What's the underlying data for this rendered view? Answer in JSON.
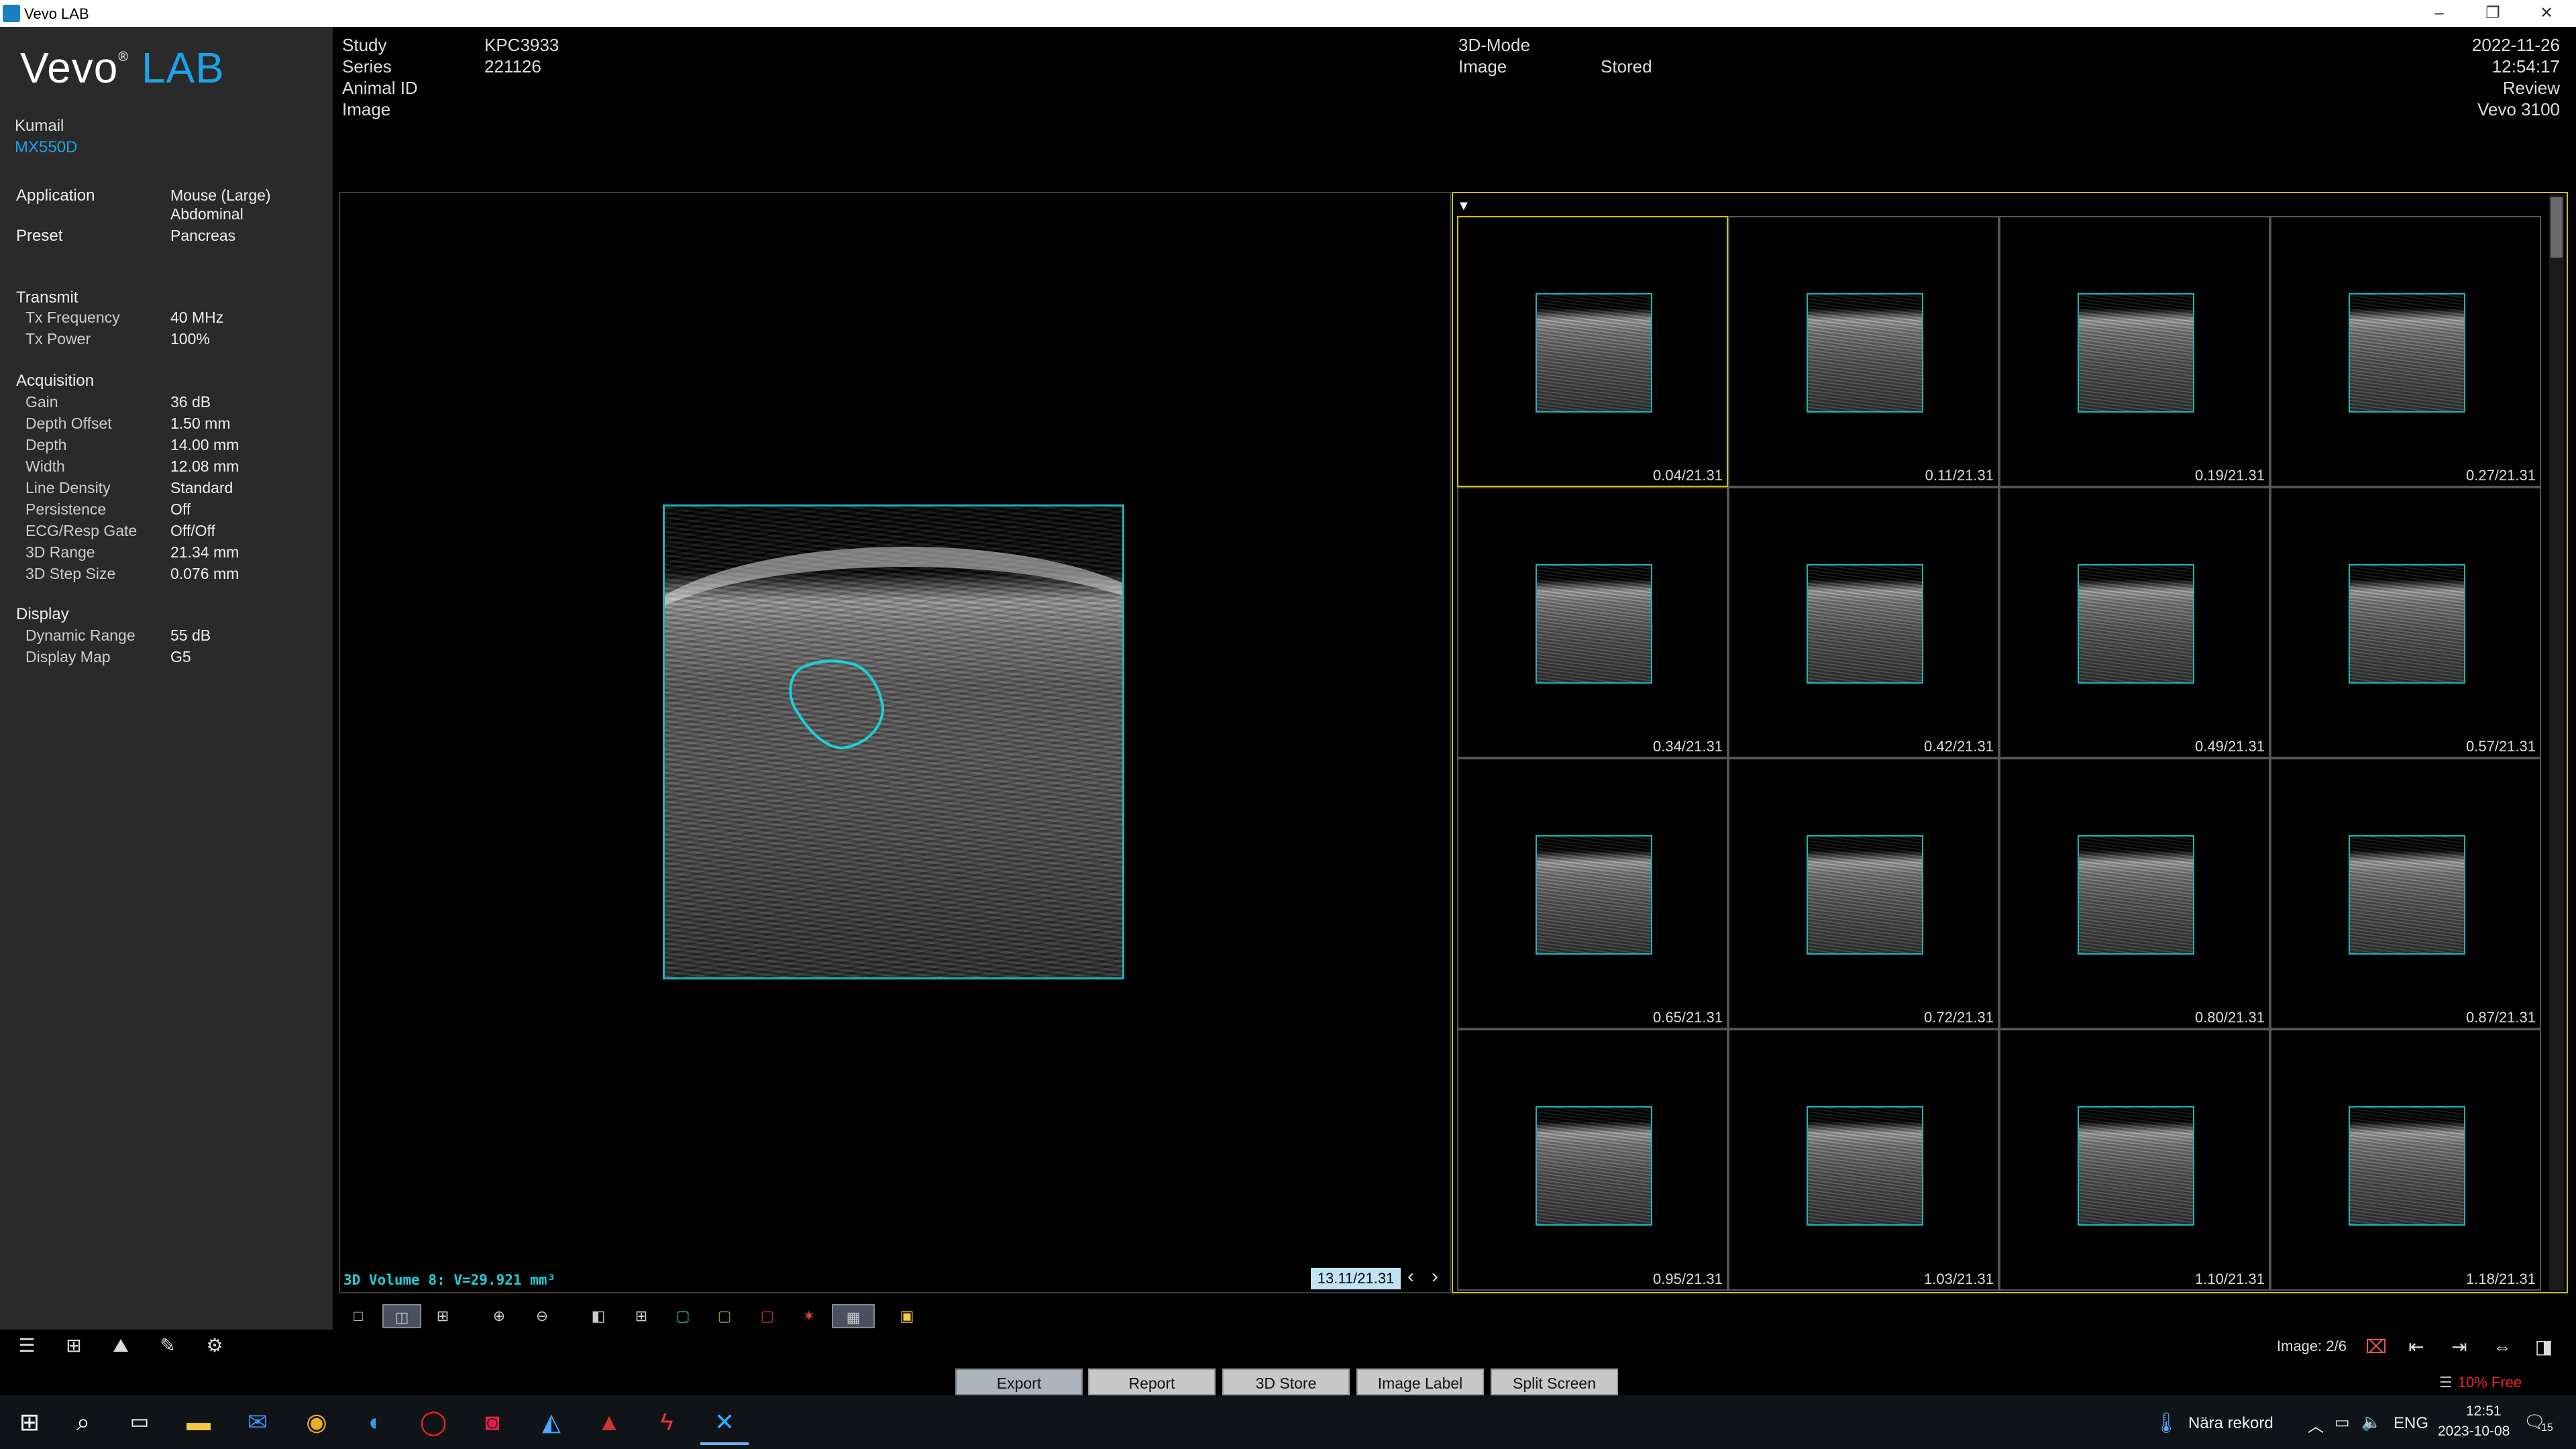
{
  "window": {
    "title": "Vevo LAB"
  },
  "logo": {
    "vevo": "Vevo",
    "reg": "®",
    "lab": "LAB"
  },
  "user": {
    "name": "Kumail",
    "transducer": "MX550D"
  },
  "info": {
    "application_label": "Application",
    "application_value": "Mouse (Large)",
    "application_value2": "Abdominal",
    "preset_label": "Preset",
    "preset_value": "Pancreas",
    "transmit_section": "Transmit",
    "transmit": [
      {
        "label": "Tx Frequency",
        "value": "40 MHz"
      },
      {
        "label": "Tx Power",
        "value": "100%"
      }
    ],
    "acquisition_section": "Acquisition",
    "acquisition": [
      {
        "label": "Gain",
        "value": "36 dB"
      },
      {
        "label": "Depth Offset",
        "value": "1.50 mm"
      },
      {
        "label": "Depth",
        "value": "14.00 mm"
      },
      {
        "label": "Width",
        "value": "12.08 mm"
      },
      {
        "label": "Line Density",
        "value": "Standard"
      },
      {
        "label": "Persistence",
        "value": "Off"
      },
      {
        "label": "ECG/Resp Gate",
        "value": "Off/Off"
      },
      {
        "label": "3D Range",
        "value": "21.34 mm"
      },
      {
        "label": "3D Step Size",
        "value": "0.076 mm"
      }
    ],
    "display_section": "Display",
    "display": [
      {
        "label": "Dynamic Range",
        "value": "55 dB"
      },
      {
        "label": "Display Map",
        "value": "G5"
      }
    ]
  },
  "header": {
    "study_label": "Study",
    "study_value": "KPC3933",
    "series_label": "Series",
    "series_value": "221126",
    "animal_label": "Animal ID",
    "image_label": "Image",
    "mode": "3D-Mode",
    "image2_label": "Image",
    "image2_value": "Stored",
    "date": "2022-11-26",
    "time": "12:54:17",
    "status": "Review",
    "system": "Vevo 3100"
  },
  "viewer": {
    "volume_text": "3D Volume 8: V=29.921 mm³",
    "frame_indicator": "13.11/21.31",
    "prev": "‹",
    "next": "›"
  },
  "thumbnails": [
    "0.04/21.31",
    "0.11/21.31",
    "0.19/21.31",
    "0.27/21.31",
    "0.34/21.31",
    "0.42/21.31",
    "0.49/21.31",
    "0.57/21.31",
    "0.65/21.31",
    "0.72/21.31",
    "0.80/21.31",
    "0.87/21.31",
    "0.95/21.31",
    "1.03/21.31",
    "1.10/21.31",
    "1.18/21.31"
  ],
  "image_count": "Image: 2/6",
  "buttons": {
    "export": "Export",
    "report": "Report",
    "store3d": "3D Store",
    "image_label": "Image Label",
    "split": "Split Screen"
  },
  "free_space": "10% Free",
  "taskbar": {
    "weather": "Nära rekord",
    "lang": "ENG",
    "clock_time": "12:51",
    "clock_date": "2023-10-08",
    "notifications": "15"
  },
  "colors": {
    "accent": "#1aa3e8",
    "roi": "#1bb5bf",
    "selection": "#c8c20a",
    "warning": "#e22233"
  }
}
